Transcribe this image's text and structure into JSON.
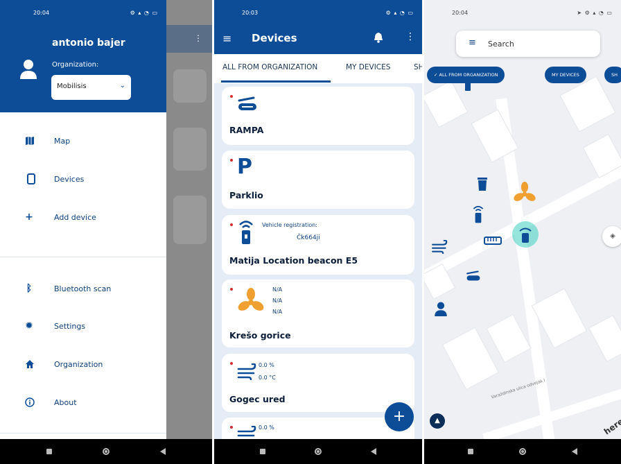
{
  "screen1": {
    "status_time": "20:04",
    "user_name": "antonio bajer",
    "org_label": "Organization:",
    "org_value": "Mobilisis",
    "menu": [
      {
        "icon": "map-icon",
        "label": "Map"
      },
      {
        "icon": "phone-icon",
        "label": "Devices"
      },
      {
        "icon": "plus-icon",
        "label": "Add device"
      }
    ],
    "menu2": [
      {
        "icon": "bluetooth-icon",
        "label": "Bluetooth scan"
      },
      {
        "icon": "gear-icon",
        "label": "Settings"
      },
      {
        "icon": "home-icon",
        "label": "Organization"
      },
      {
        "icon": "info-icon",
        "label": "About"
      }
    ]
  },
  "screen2": {
    "status_time": "20:03",
    "title": "Devices",
    "tabs": [
      "ALL FROM ORGANIZATION",
      "MY DEVICES",
      "SH"
    ],
    "devices": [
      {
        "name": "RAMPA",
        "icon": "barrier-icon"
      },
      {
        "name": "Parklio",
        "icon": "parking-icon"
      },
      {
        "name": "Matija Location beacon E5",
        "icon": "beacon-icon",
        "info_label": "Vehicle registration:",
        "info_value": "Čk664ji"
      },
      {
        "name": "Krešo gorice",
        "icon": "fan-icon",
        "values": [
          "N/A",
          "N/A",
          "N/A"
        ]
      },
      {
        "name": "Gogec ured",
        "icon": "wind-icon",
        "values": [
          "0.0 %",
          "0.0 °C"
        ]
      },
      {
        "icon": "wind-icon",
        "values": [
          "0.0 %"
        ]
      }
    ]
  },
  "screen3": {
    "status_time": "20:04",
    "search_placeholder": "Search",
    "chips": [
      "ALL FROM ORGANIZATION",
      "MY DEVICES",
      "SH"
    ],
    "street_label": "Varaždinska ulica odvojak I",
    "map_brand": "here"
  },
  "colors": {
    "primary": "#0d4c97",
    "accent_orange": "#f0a030",
    "beacon_teal": "#3ecfc0",
    "status_dot": "#d32f2f"
  }
}
